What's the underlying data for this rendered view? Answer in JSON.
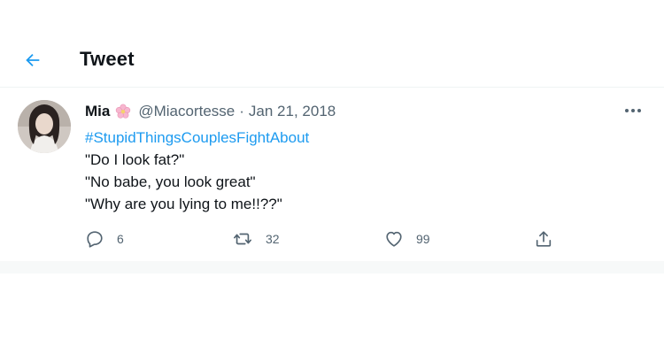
{
  "header": {
    "title": "Tweet"
  },
  "tweet": {
    "author_name": "Mia",
    "handle": "@Miacortesse",
    "separator": "·",
    "date": "Jan 21, 2018",
    "hashtag": "#StupidThingsCouplesFightAbout",
    "lines": [
      "\"Do I look fat?\"",
      "\"No babe, you look great\"",
      "\"Why are you lying to me!!??\""
    ],
    "stats": {
      "replies": "6",
      "retweets": "32",
      "likes": "99"
    }
  },
  "icons": {
    "back": "arrow-left-icon",
    "author_emoji": "cherry-blossom-icon",
    "more": "more-dots-icon",
    "reply": "reply-icon",
    "retweet": "retweet-icon",
    "like": "heart-icon",
    "share": "share-icon"
  },
  "colors": {
    "accent": "#1d9bf0",
    "text": "#0f1419",
    "muted": "#536471"
  }
}
